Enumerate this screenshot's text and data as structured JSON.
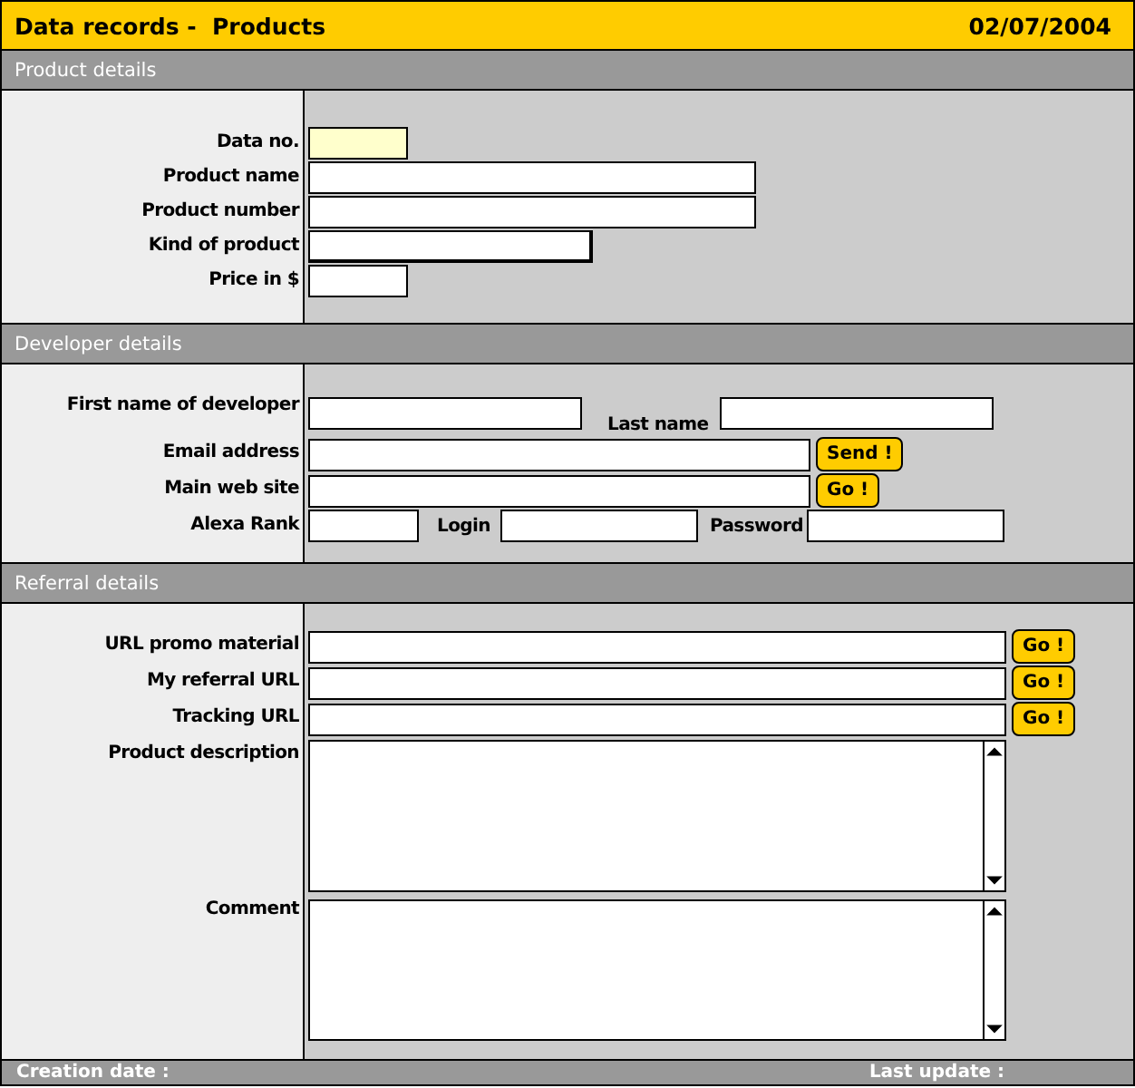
{
  "header": {
    "title": "Data records -  Products",
    "date": "02/07/2004"
  },
  "sections": [
    {
      "title": "Product details",
      "rows": [
        {
          "label": "Data no.",
          "controls": [
            {
              "kind": "input",
              "readonly": true
            }
          ]
        },
        {
          "label": "Product name",
          "controls": [
            {
              "kind": "input",
              "readonly": false
            }
          ]
        },
        {
          "label": "Product number",
          "controls": [
            {
              "kind": "input",
              "readonly": false
            }
          ]
        },
        {
          "label": "Kind of product",
          "controls": [
            {
              "kind": "input",
              "readonly": false
            }
          ]
        },
        {
          "label": "Price in $",
          "controls": [
            {
              "kind": "input",
              "readonly": false
            }
          ]
        }
      ]
    },
    {
      "title": "Developer details",
      "rows": [
        {
          "label": "First name of developer",
          "controls": [
            {
              "kind": "input",
              "readonly": false
            },
            {
              "kind": "label",
              "text": "Last name"
            },
            {
              "kind": "input",
              "readonly": false
            }
          ]
        },
        {
          "label": "Email address",
          "controls": [
            {
              "kind": "input",
              "readonly": false
            },
            {
              "kind": "button",
              "text": "Send !"
            }
          ]
        },
        {
          "label": "Main web site",
          "controls": [
            {
              "kind": "input",
              "readonly": false
            },
            {
              "kind": "button",
              "text": "Go !"
            }
          ]
        },
        {
          "label": "Alexa Rank",
          "controls": [
            {
              "kind": "input",
              "readonly": false
            },
            {
              "kind": "label",
              "text": "Login"
            },
            {
              "kind": "input",
              "readonly": false
            },
            {
              "kind": "label",
              "text": "Password"
            },
            {
              "kind": "input",
              "readonly": false
            }
          ]
        }
      ]
    },
    {
      "title": "Referral details",
      "rows": [
        {
          "label": "URL promo material",
          "controls": [
            {
              "kind": "input",
              "readonly": false
            },
            {
              "kind": "button",
              "text": "Go !"
            }
          ]
        },
        {
          "label": "My referral URL",
          "controls": [
            {
              "kind": "input",
              "readonly": false
            },
            {
              "kind": "button",
              "text": "Go !"
            }
          ]
        },
        {
          "label": "Tracking URL",
          "controls": [
            {
              "kind": "input",
              "readonly": false
            },
            {
              "kind": "button",
              "text": "Go !"
            }
          ]
        },
        {
          "label": "Product description",
          "controls": [
            {
              "kind": "textarea"
            }
          ]
        },
        {
          "label": "Comment",
          "controls": [
            {
              "kind": "textarea"
            }
          ]
        }
      ]
    }
  ],
  "footer": {
    "created": "Creation date :",
    "updated": "Last update :"
  }
}
